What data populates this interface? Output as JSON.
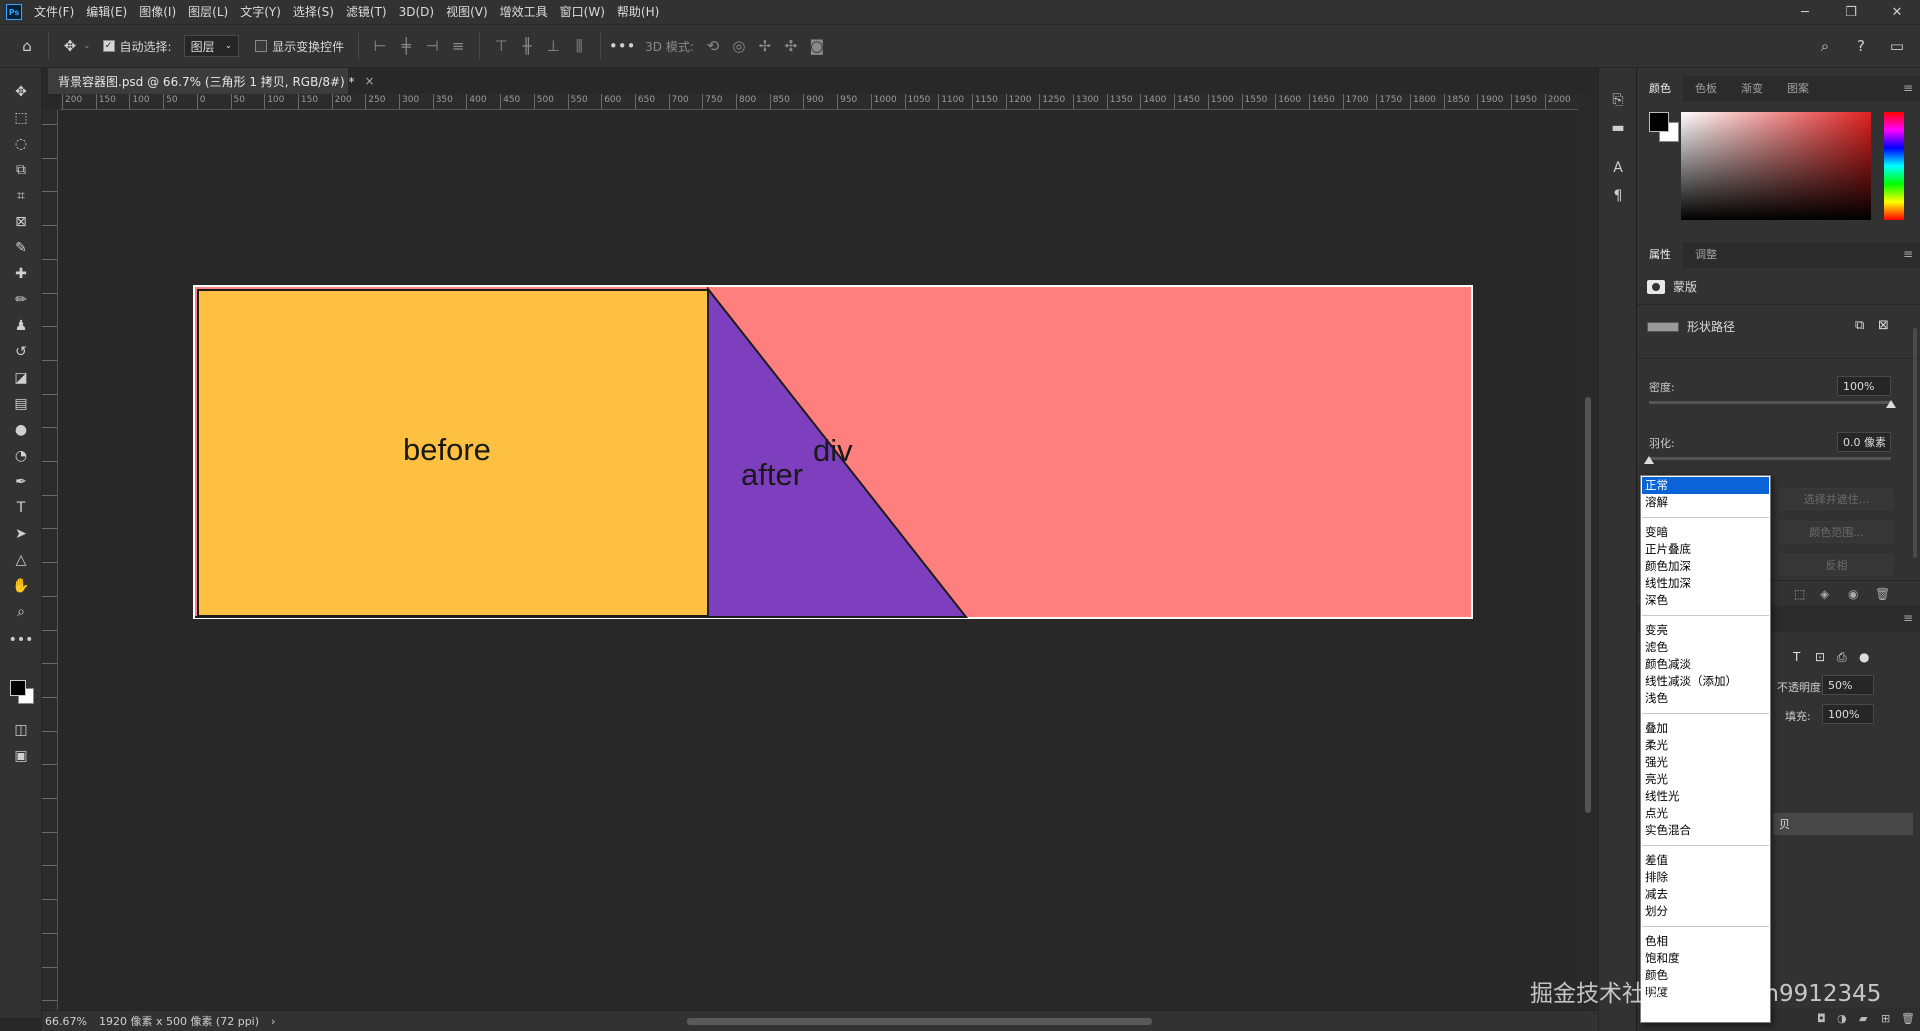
{
  "app": {
    "logo": "Ps"
  },
  "menu": [
    "文件(F)",
    "编辑(E)",
    "图像(I)",
    "图层(L)",
    "文字(Y)",
    "选择(S)",
    "滤镜(T)",
    "3D(D)",
    "视图(V)",
    "增效工具",
    "窗口(W)",
    "帮助(H)"
  ],
  "window_controls": {
    "minimize": "─",
    "restore": "❐",
    "close": "✕"
  },
  "options_bar": {
    "auto_select_label": "自动选择:",
    "auto_select_target": "图层",
    "show_transform_label": "显示变换控件",
    "mode_3d_label": "3D 模式:"
  },
  "document_tab": {
    "title": "背景容器图.psd @ 66.7% (三角形 1 拷贝, RGB/8#) *",
    "close": "×"
  },
  "ruler_labels": [
    "200",
    "150",
    "100",
    "50",
    "0",
    "50",
    "100",
    "150",
    "200",
    "250",
    "300",
    "350",
    "400",
    "450",
    "500",
    "550",
    "600",
    "650",
    "700",
    "750",
    "800",
    "850",
    "900",
    "950",
    "1000",
    "1050",
    "1100",
    "1150",
    "1200",
    "1250",
    "1300",
    "1350",
    "1400",
    "1450",
    "1500",
    "1550",
    "1600",
    "1650",
    "1700",
    "1750",
    "1800",
    "1850",
    "1900",
    "1950",
    "2000",
    "205"
  ],
  "canvas": {
    "before_text": "before",
    "after_text": "after",
    "div_text": "div",
    "colors": {
      "before": "#fec040",
      "after": "#7e3fbf",
      "div": "#ff7f7f"
    }
  },
  "status": {
    "zoom": "66.67%",
    "doc_info": "1920 像素 x 500 像素 (72 ppi)",
    "arrow": "›"
  },
  "color_panel": {
    "tabs": [
      "颜色",
      "色板",
      "渐变",
      "图案"
    ],
    "active": 0
  },
  "properties_panel": {
    "tabs": [
      "属性",
      "调整"
    ],
    "mask_label": "蒙版",
    "vector_mask_label": "形状路径",
    "density_label": "密度:",
    "density_value": "100%",
    "density_level": 1.0,
    "feather_label": "羽化:",
    "feather_value": "0.0 像素",
    "feather_level": 0.0,
    "btn_select_mask": "选择并遮住...",
    "btn_color_range": "颜色范围...",
    "btn_invert": "反相"
  },
  "layers_panel": {
    "opacity_label": "不透明度:",
    "opacity_value": "50%",
    "fill_label": "填充:",
    "fill_value": "100%",
    "partial_layer_text": "贝"
  },
  "blend_dropdown": {
    "groups": [
      [
        "正常",
        "溶解"
      ],
      [
        "变暗",
        "正片叠底",
        "颜色加深",
        "线性加深",
        "深色"
      ],
      [
        "变亮",
        "滤色",
        "颜色减淡",
        "线性减淡（添加）",
        "浅色"
      ],
      [
        "叠加",
        "柔光",
        "强光",
        "亮光",
        "线性光",
        "点光",
        "实色混合"
      ],
      [
        "差值",
        "排除",
        "减去",
        "划分"
      ],
      [
        "色相",
        "饱和度",
        "颜色",
        "明度"
      ]
    ],
    "selected": "正常"
  },
  "watermark": "掘金技术社区 @ Conan9912345"
}
